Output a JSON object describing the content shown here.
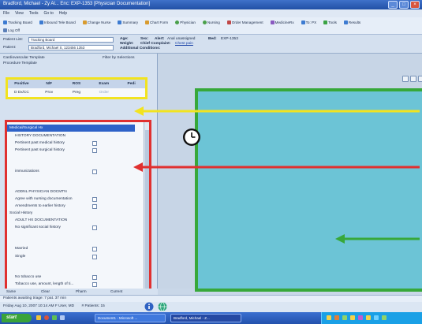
{
  "window": {
    "title": "Bradford, Michael - Zy Al... Enc: EXP-1353 [Physician Documentation]"
  },
  "menu": [
    "File",
    "View",
    "Tools",
    "Go to",
    "Help"
  ],
  "toolbar": {
    "row1": [
      {
        "icon": "list-icon",
        "label": "Tracking Board"
      },
      {
        "icon": "list-icon",
        "label": "Inbound Tele Board"
      },
      {
        "icon": "clipboard-icon",
        "label": "Change Nurse"
      },
      {
        "icon": "list-icon",
        "label": "Summary"
      },
      {
        "icon": "clipboard-icon",
        "label": "Chart Form"
      },
      {
        "icon": "person-icon",
        "label": "Physician"
      },
      {
        "icon": "person-icon",
        "label": "Nursing"
      },
      {
        "icon": "order-icon",
        "label": "Order Management"
      },
      {
        "icon": "pill-icon",
        "label": "MedicineRx"
      },
      {
        "icon": "list-icon",
        "label": "To: PX"
      },
      {
        "icon": "folder-icon",
        "label": "Tools"
      },
      {
        "icon": "list-icon",
        "label": "Results"
      }
    ],
    "row2": [
      {
        "icon": "exit-icon",
        "label": "Log Off"
      }
    ]
  },
  "banner": {
    "patient_list_label": "Patient List:",
    "patient_list_value": "Tracking Board",
    "patient_label": "Patient:",
    "patient_value": "Bradford, Michael S, 123456 1353",
    "age_label": "Age:",
    "sex_label": "Sex:",
    "allergy_label": "Alert:",
    "allergy_value": "Anal unassigned",
    "bed_label": "Bed:",
    "bed_value": "EXP-1353",
    "weight_label": "Weight:",
    "complaint_label": "Chief Complaint:",
    "complaint_value": "Chest pain",
    "conditions_label": "Additional Conditions:"
  },
  "left_panel": {
    "header1": "Cardiovascular Template",
    "header2": "Procedure Template",
    "filter_label": "Filter by Selections",
    "grid_headers": [
      "Positive",
      "N/F",
      "ROS",
      "Exam",
      "Pedi"
    ],
    "grid_row": [
      "D Dx/CC",
      "Prov",
      "Preg",
      "Order",
      ""
    ],
    "tree": [
      {
        "label": "Medical/Surgical Hx",
        "selected": true,
        "indent": 0
      },
      {
        "label": "HISTORY DOCUMENTATION",
        "selected": false,
        "indent": 1
      },
      {
        "label": "Pertinent past medical history",
        "selected": false,
        "indent": 1,
        "checkbox": true
      },
      {
        "label": "Pertinent past surgical history",
        "selected": false,
        "indent": 1,
        "checkbox": true
      },
      {
        "label": "immunizations",
        "selected": false,
        "indent": 1,
        "checkbox": true
      },
      {
        "label": "ADDNL PHYSICIAN DOCMTN",
        "selected": false,
        "indent": 1
      },
      {
        "label": "Agree with nursing documentation",
        "selected": false,
        "indent": 1,
        "checkbox": true
      },
      {
        "label": "Amendments to earlier history",
        "selected": false,
        "indent": 1,
        "checkbox": true
      },
      {
        "label": "Social History",
        "selected": false,
        "indent": 0
      },
      {
        "label": "ADULT HX DOCUMENTATION",
        "selected": false,
        "indent": 1
      },
      {
        "label": "No significant social history",
        "selected": false,
        "indent": 1,
        "checkbox": true
      },
      {
        "label": "Married",
        "selected": false,
        "indent": 1,
        "checkbox": true
      },
      {
        "label": "Single",
        "selected": false,
        "indent": 1,
        "checkbox": true
      },
      {
        "label": "No tobacco use",
        "selected": false,
        "indent": 1,
        "checkbox": true
      },
      {
        "label": "Tobacco use, amount, length of ti...",
        "selected": false,
        "indent": 1,
        "checkbox": true
      }
    ],
    "bottom_buttons": [
      "Same",
      "Clear",
      "Pharm",
      "Current"
    ]
  },
  "status": {
    "line1": "Patients awaiting triage: 7 pat. 37 min",
    "line2": "Friday Aug 10, 2007 10:14 AM F User, MD",
    "line2b": "# Patients: 15"
  },
  "taskbar": {
    "start_label": "start",
    "tasks": [
      "Document1 - Microsoft ...",
      "Bradford, Michael - Z..."
    ]
  },
  "colors": {
    "highlight_yellow": "#f2e31f",
    "highlight_red": "#e03030",
    "highlight_green": "#37a83a",
    "content_teal": "#6cc4d6",
    "selection_blue": "#2e62c8"
  }
}
